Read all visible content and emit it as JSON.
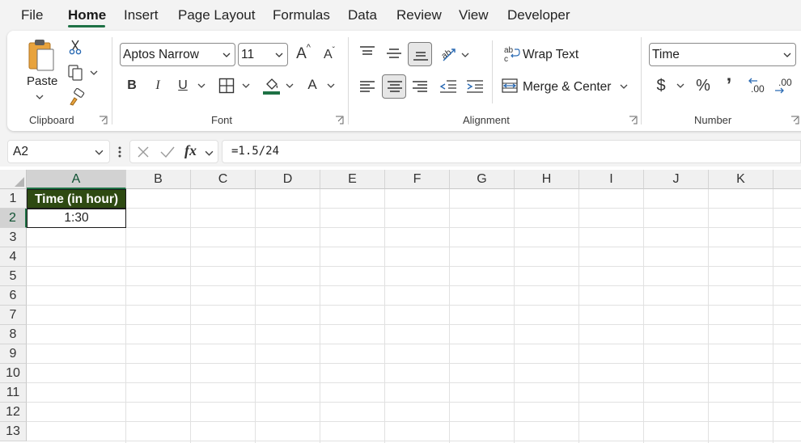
{
  "menu": {
    "tabs": [
      "File",
      "Home",
      "Insert",
      "Page Layout",
      "Formulas",
      "Data",
      "Review",
      "View",
      "Developer"
    ],
    "active_tab": "Home"
  },
  "ribbon": {
    "clipboard": {
      "paste_label": "Paste",
      "group_label": "Clipboard"
    },
    "font": {
      "font_name": "Aptos Narrow",
      "font_size": "11",
      "bold": "B",
      "italic": "I",
      "underline": "U",
      "grow_font": "A",
      "shrink_font": "A",
      "font_color": "A",
      "group_label": "Font"
    },
    "alignment": {
      "wrap_text": "Wrap Text",
      "merge_center": "Merge & Center",
      "group_label": "Alignment"
    },
    "number": {
      "format": "Time",
      "currency": "$",
      "percent": "%",
      "comma": "’",
      "increase_decimal": ".00",
      "decrease_decimal": ".00",
      "group_label": "Number"
    }
  },
  "formula_bar": {
    "name_box": "A2",
    "fx": "fx",
    "formula": "=1.5/24"
  },
  "sheet": {
    "columns": [
      "A",
      "B",
      "C",
      "D",
      "E",
      "F",
      "G",
      "H",
      "I",
      "J",
      "K"
    ],
    "rows": [
      "1",
      "2",
      "3",
      "4",
      "5",
      "6",
      "7",
      "8",
      "9",
      "10",
      "11",
      "12",
      "13"
    ],
    "selected_column": "A",
    "selected_row": "2",
    "cells": {
      "A1": "Time (in hour)",
      "A2": "1:30"
    }
  },
  "colors": {
    "accent": "#1e7145",
    "header_fill": "#2e4a12",
    "font_color_bar": "#1e7145"
  }
}
